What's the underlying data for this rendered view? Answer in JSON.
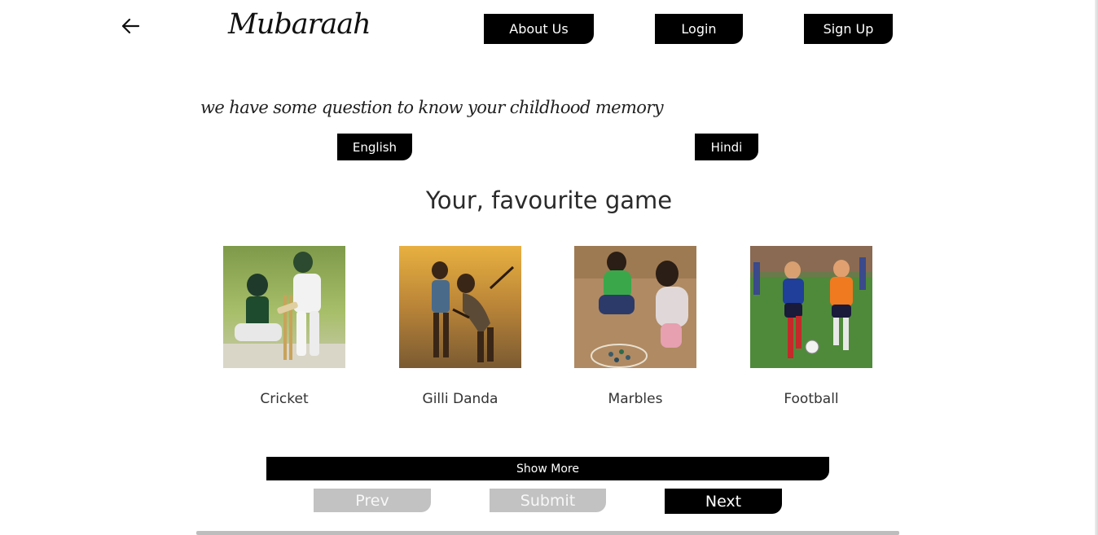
{
  "header": {
    "brand": "Mubaraah",
    "nav": {
      "about": "About Us",
      "login": "Login",
      "signup": "Sign Up"
    }
  },
  "intro_text": "we have some question to know your childhood memory",
  "languages": {
    "english": "English",
    "hindi": "Hindi"
  },
  "question": "Your, favourite game",
  "options": [
    {
      "label": "Cricket"
    },
    {
      "label": "Gilli Danda"
    },
    {
      "label": "Marbles"
    },
    {
      "label": "Football"
    }
  ],
  "actions": {
    "show_more": "Show More",
    "prev": "Prev",
    "submit": "Submit",
    "next": "Next"
  },
  "colors": {
    "button_bg": "#000000",
    "button_text": "#ffffff",
    "disabled_bg": "#c2c2c2"
  }
}
